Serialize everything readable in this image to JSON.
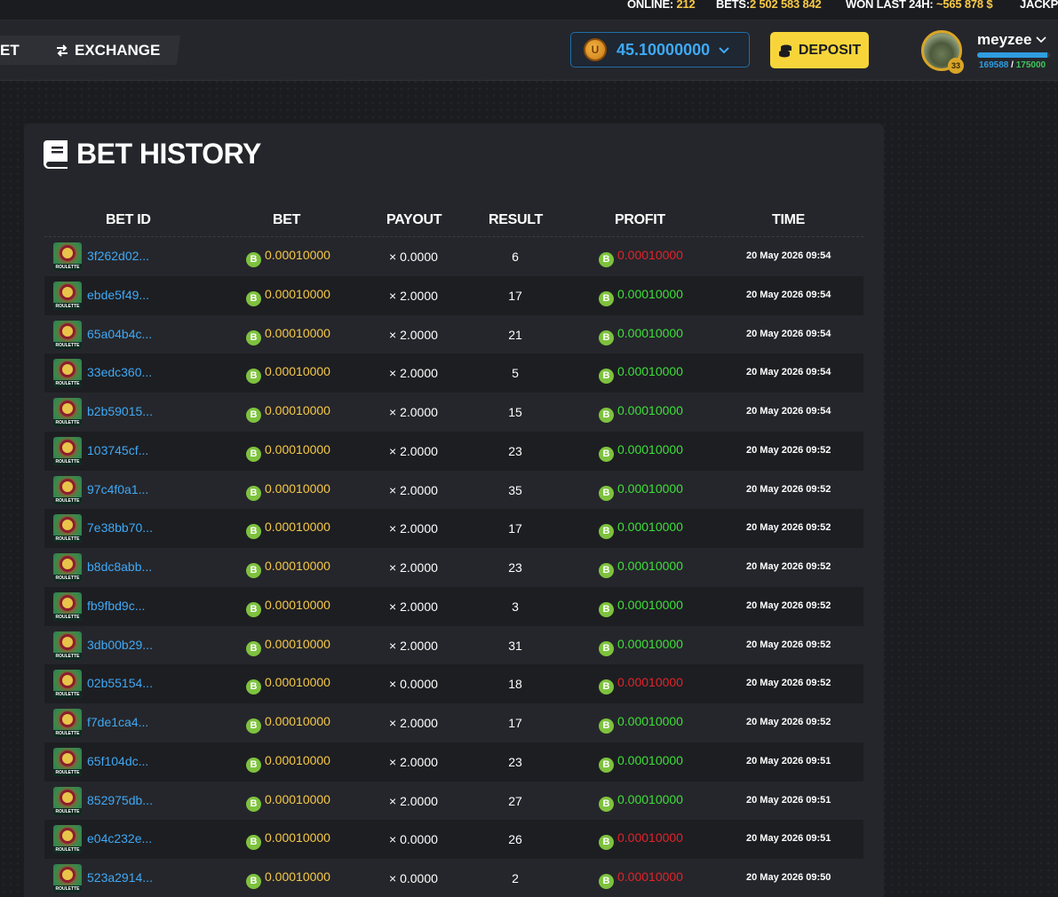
{
  "stats": {
    "online_label": "ONLINE:",
    "online_value": "212",
    "bets_label": "BETS:",
    "bets_value": "2 502 583 842",
    "won_label": "WON LAST 24H:",
    "won_value": "~565 878 $",
    "jackpot_label": "JACKP"
  },
  "nav": {
    "partial_label": "ET",
    "exchange_label": "EXCHANGE"
  },
  "balance": {
    "value": "45.10000000",
    "coin_icon": "coin-icon"
  },
  "deposit_label": "DEPOSIT",
  "user": {
    "name": "meyzee",
    "level": "33",
    "xp_current": "169588",
    "xp_separator": "/",
    "xp_max": "175000",
    "xp_fraction": 0.969
  },
  "page": {
    "title": "BET HISTORY"
  },
  "columns": [
    "BET ID",
    "BET",
    "PAYOUT",
    "RESULT",
    "PROFIT",
    "TIME"
  ],
  "game_tag": "ROULETTE",
  "btc_symbol": "B",
  "colors": {
    "accent_blue": "#3fa9f5",
    "gold": "#f7c948",
    "win": "#3fdf3a",
    "loss": "#e0242b",
    "deposit": "#f7d53a"
  },
  "rows": [
    {
      "id": "3f262d02...",
      "bet": "0.00010000",
      "payout": "× 0.0000",
      "result": "6",
      "profit": "0.00010000",
      "outcome": "loss",
      "time": "20 May 2026 09:54"
    },
    {
      "id": "ebde5f49...",
      "bet": "0.00010000",
      "payout": "× 2.0000",
      "result": "17",
      "profit": "0.00010000",
      "outcome": "win",
      "time": "20 May 2026 09:54"
    },
    {
      "id": "65a04b4c...",
      "bet": "0.00010000",
      "payout": "× 2.0000",
      "result": "21",
      "profit": "0.00010000",
      "outcome": "win",
      "time": "20 May 2026 09:54"
    },
    {
      "id": "33edc360...",
      "bet": "0.00010000",
      "payout": "× 2.0000",
      "result": "5",
      "profit": "0.00010000",
      "outcome": "win",
      "time": "20 May 2026 09:54"
    },
    {
      "id": "b2b59015...",
      "bet": "0.00010000",
      "payout": "× 2.0000",
      "result": "15",
      "profit": "0.00010000",
      "outcome": "win",
      "time": "20 May 2026 09:54"
    },
    {
      "id": "103745cf...",
      "bet": "0.00010000",
      "payout": "× 2.0000",
      "result": "23",
      "profit": "0.00010000",
      "outcome": "win",
      "time": "20 May 2026 09:52"
    },
    {
      "id": "97c4f0a1...",
      "bet": "0.00010000",
      "payout": "× 2.0000",
      "result": "35",
      "profit": "0.00010000",
      "outcome": "win",
      "time": "20 May 2026 09:52"
    },
    {
      "id": "7e38bb70...",
      "bet": "0.00010000",
      "payout": "× 2.0000",
      "result": "17",
      "profit": "0.00010000",
      "outcome": "win",
      "time": "20 May 2026 09:52"
    },
    {
      "id": "b8dc8abb...",
      "bet": "0.00010000",
      "payout": "× 2.0000",
      "result": "23",
      "profit": "0.00010000",
      "outcome": "win",
      "time": "20 May 2026 09:52"
    },
    {
      "id": "fb9fbd9c...",
      "bet": "0.00010000",
      "payout": "× 2.0000",
      "result": "3",
      "profit": "0.00010000",
      "outcome": "win",
      "time": "20 May 2026 09:52"
    },
    {
      "id": "3db00b29...",
      "bet": "0.00010000",
      "payout": "× 2.0000",
      "result": "31",
      "profit": "0.00010000",
      "outcome": "win",
      "time": "20 May 2026 09:52"
    },
    {
      "id": "02b55154...",
      "bet": "0.00010000",
      "payout": "× 0.0000",
      "result": "18",
      "profit": "0.00010000",
      "outcome": "loss",
      "time": "20 May 2026 09:52"
    },
    {
      "id": "f7de1ca4...",
      "bet": "0.00010000",
      "payout": "× 2.0000",
      "result": "17",
      "profit": "0.00010000",
      "outcome": "win",
      "time": "20 May 2026 09:52"
    },
    {
      "id": "65f104dc...",
      "bet": "0.00010000",
      "payout": "× 2.0000",
      "result": "23",
      "profit": "0.00010000",
      "outcome": "win",
      "time": "20 May 2026 09:51"
    },
    {
      "id": "852975db...",
      "bet": "0.00010000",
      "payout": "× 2.0000",
      "result": "27",
      "profit": "0.00010000",
      "outcome": "win",
      "time": "20 May 2026 09:51"
    },
    {
      "id": "e04c232e...",
      "bet": "0.00010000",
      "payout": "× 0.0000",
      "result": "26",
      "profit": "0.00010000",
      "outcome": "loss",
      "time": "20 May 2026 09:51"
    },
    {
      "id": "523a2914...",
      "bet": "0.00010000",
      "payout": "× 0.0000",
      "result": "2",
      "profit": "0.00010000",
      "outcome": "loss",
      "time": "20 May 2026 09:50"
    }
  ]
}
